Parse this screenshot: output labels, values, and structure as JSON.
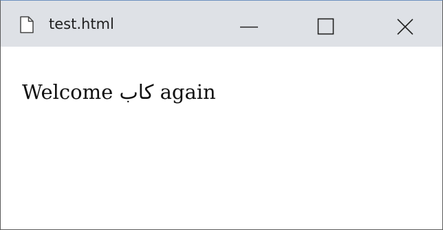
{
  "window": {
    "tab_title": "test.html",
    "tab_icon": "document-icon",
    "controls": {
      "minimize_icon": "minimize-icon",
      "maximize_icon": "maximize-icon",
      "close_icon": "close-icon"
    }
  },
  "content": {
    "text": "Welcome کاب again"
  }
}
